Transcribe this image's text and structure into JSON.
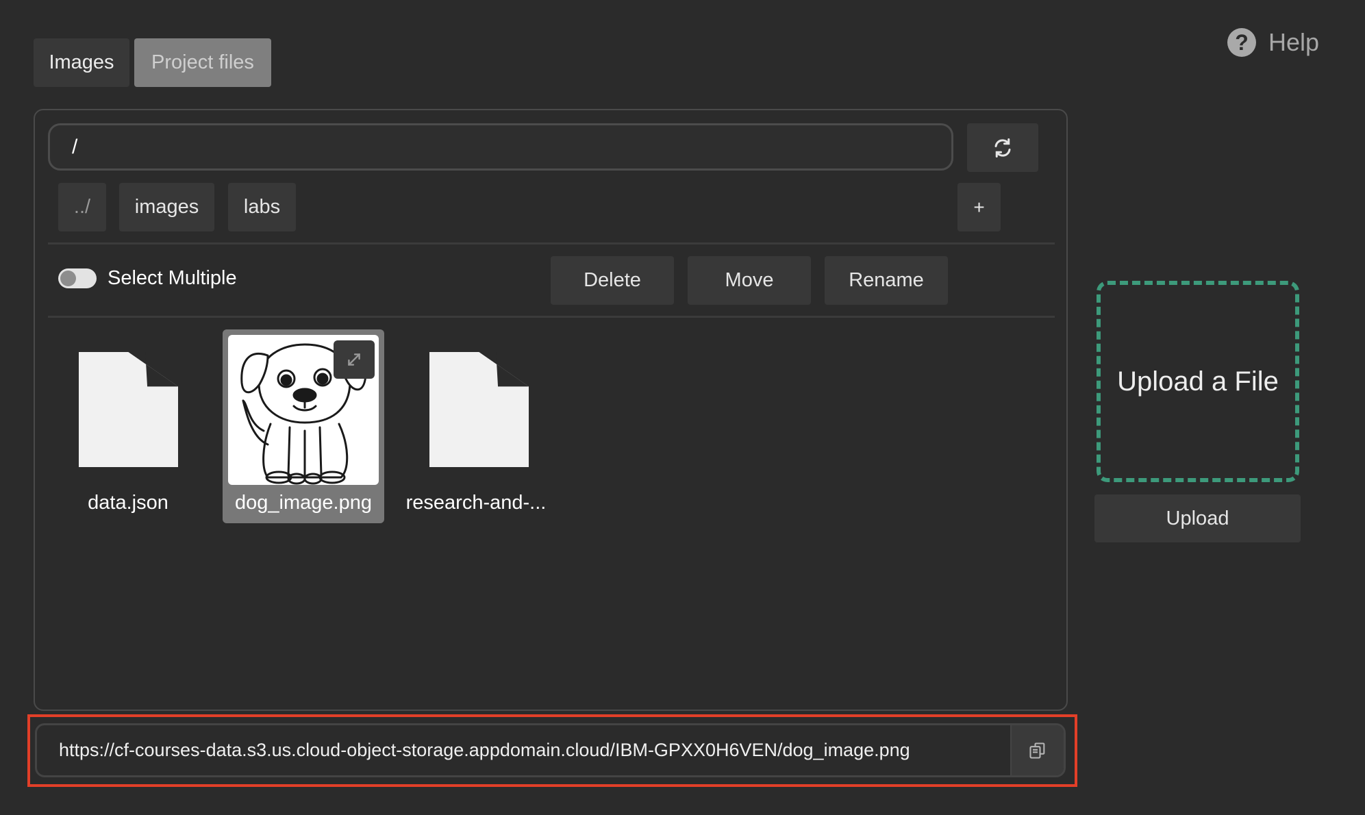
{
  "tabs": [
    {
      "label": "Images",
      "active": false
    },
    {
      "label": "Project files",
      "active": true
    }
  ],
  "help": {
    "label": "Help",
    "icon": "help-icon"
  },
  "path": {
    "value": "/"
  },
  "folders": [
    {
      "label": "../"
    },
    {
      "label": "images"
    },
    {
      "label": "labs"
    }
  ],
  "add_label": "+",
  "select_multiple": {
    "label": "Select Multiple",
    "enabled": false
  },
  "actions": {
    "delete": "Delete",
    "move": "Move",
    "rename": "Rename"
  },
  "files": [
    {
      "name": "data.json",
      "icon": "file-icon",
      "selected": false
    },
    {
      "name": "dog_image.png",
      "icon": "image-thumbnail",
      "selected": true
    },
    {
      "name": "research-and-...",
      "icon": "file-icon",
      "selected": false
    }
  ],
  "upload": {
    "dropzone_label": "Upload a File",
    "button_label": "Upload"
  },
  "url": {
    "value": "https://cf-courses-data.s3.us.cloud-object-storage.appdomain.cloud/IBM-GPXX0H6VEN/dog_image.png"
  },
  "colors": {
    "accent_dashed": "#3d9a7b",
    "highlight": "#e23f28",
    "background": "#2b2b2b"
  }
}
